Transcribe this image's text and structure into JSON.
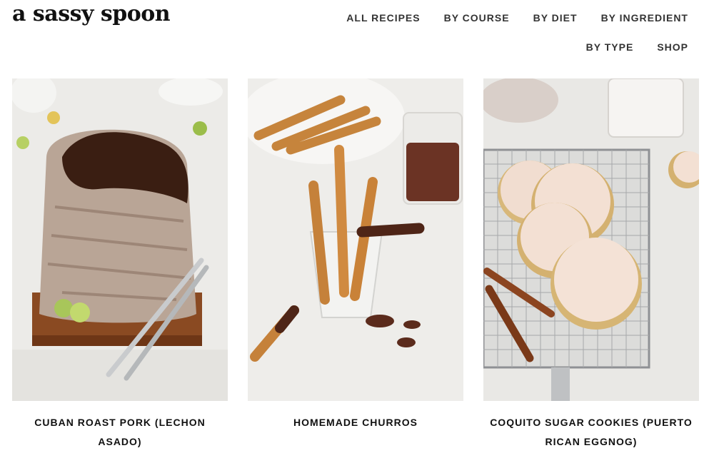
{
  "site": {
    "logo_text": "a sassy spoon"
  },
  "nav": {
    "row1": [
      "ALL RECIPES",
      "BY COURSE",
      "BY DIET",
      "BY INGREDIENT"
    ],
    "row2": [
      "BY TYPE",
      "SHOP"
    ]
  },
  "cards": [
    {
      "title": "CUBAN ROAST PORK (LECHON ASADO)"
    },
    {
      "title": "HOMEMADE CHURROS"
    },
    {
      "title": "COQUITO SUGAR COOKIES (PUERTO RICAN EGGNOG)"
    }
  ]
}
